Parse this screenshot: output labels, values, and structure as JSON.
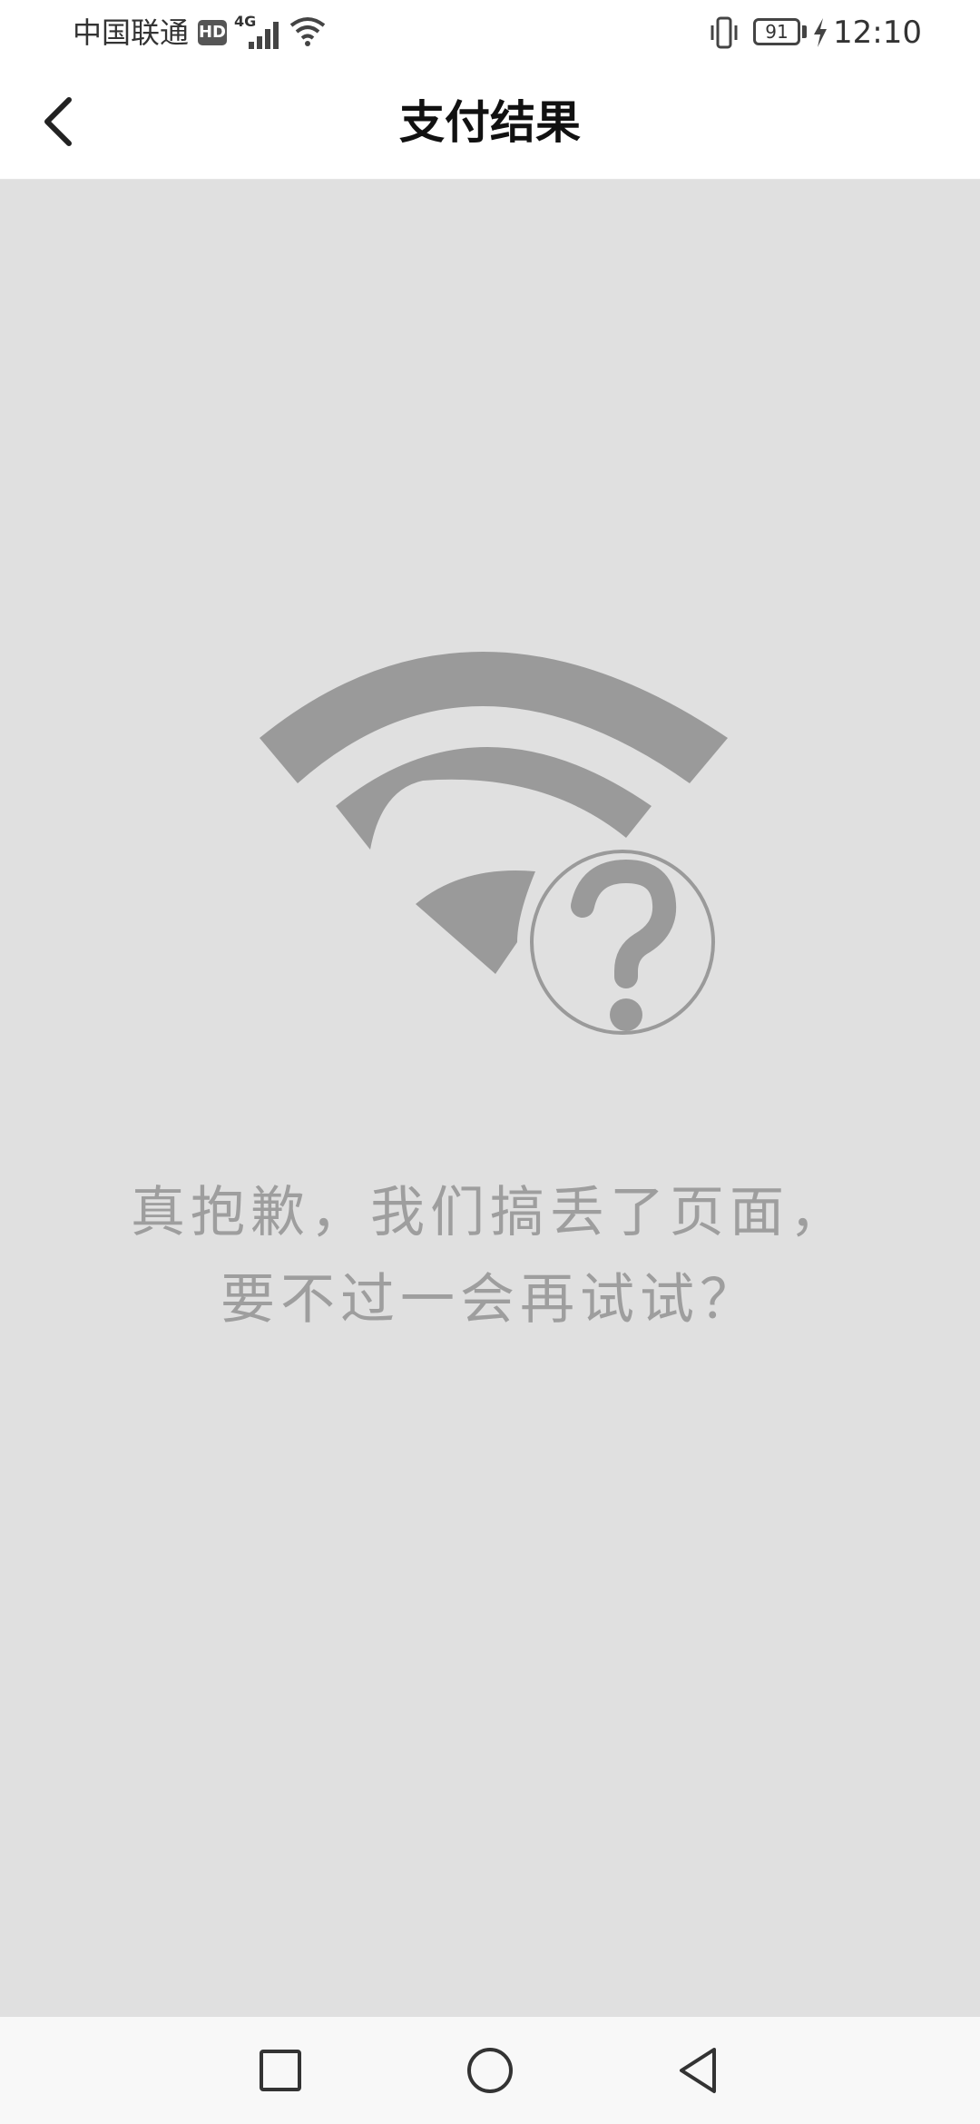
{
  "status_bar": {
    "carrier": "中国联通",
    "hd_badge": "HD",
    "network_type": "4G",
    "battery_level": "91",
    "time": "12:10"
  },
  "header": {
    "title": "支付结果"
  },
  "error": {
    "message_line1": "真抱歉，我们搞丢了页面，",
    "message_line2": "要不过一会再试试？"
  },
  "colors": {
    "content_background": "#e0e0e0",
    "icon_gray": "#9a9a9a",
    "text_gray": "#9e9e9e"
  },
  "icons": {
    "back": "chevron-left-icon",
    "illustration": "wifi-question-icon",
    "nav_recent": "square-icon",
    "nav_home": "circle-icon",
    "nav_back": "triangle-back-icon"
  }
}
